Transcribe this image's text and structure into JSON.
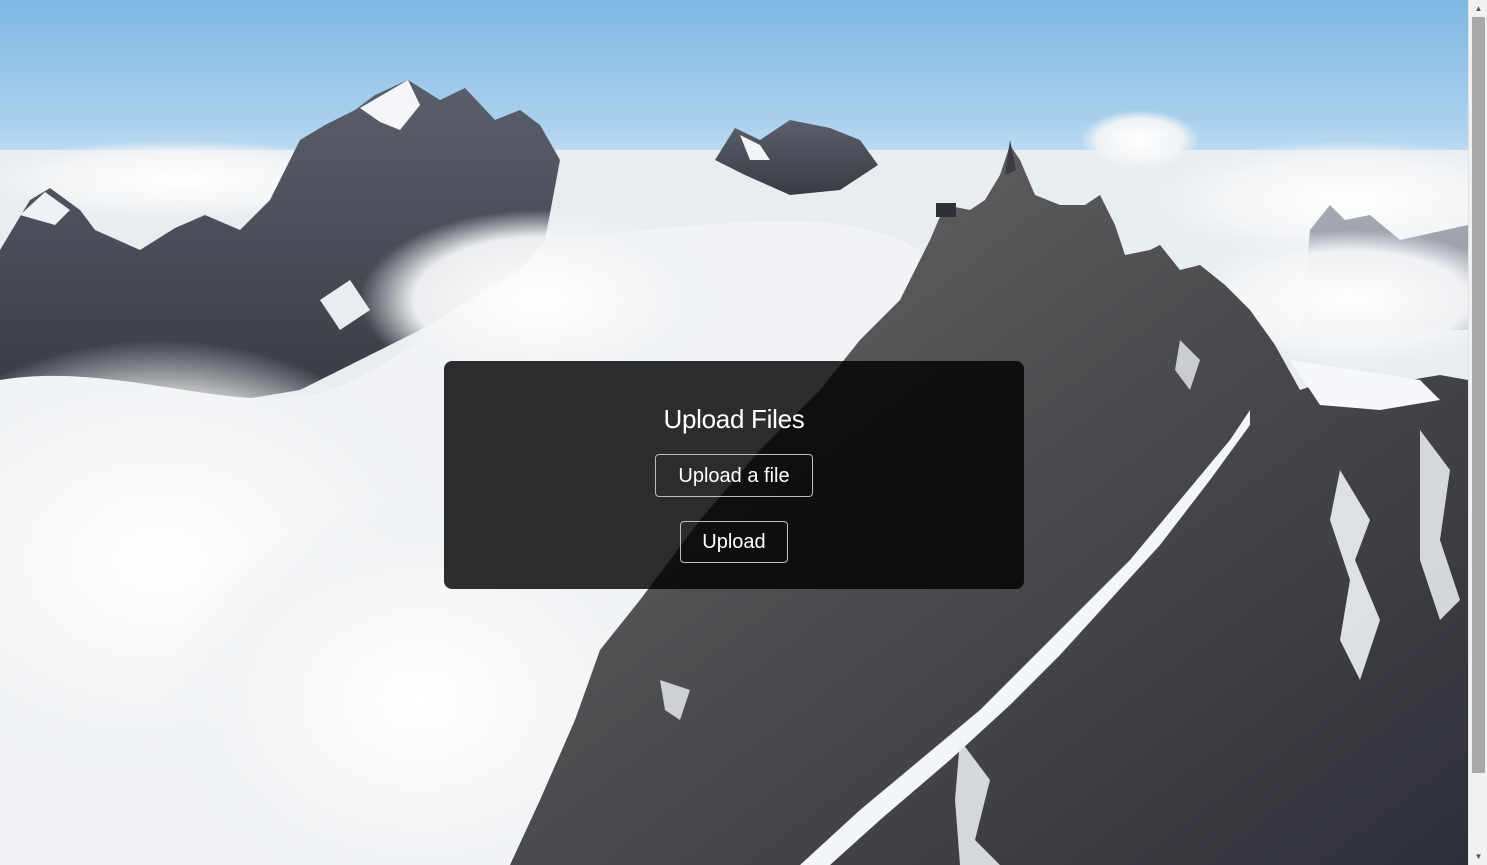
{
  "panel": {
    "title": "Upload Files",
    "file_button_label": "Upload a file",
    "upload_button_label": "Upload"
  },
  "scrollbar": {
    "up_arrow": "▲",
    "down_arrow": "▼"
  },
  "colors": {
    "panel_background": "#000000",
    "button_border": "#bdbdbd",
    "text": "#ffffff"
  }
}
